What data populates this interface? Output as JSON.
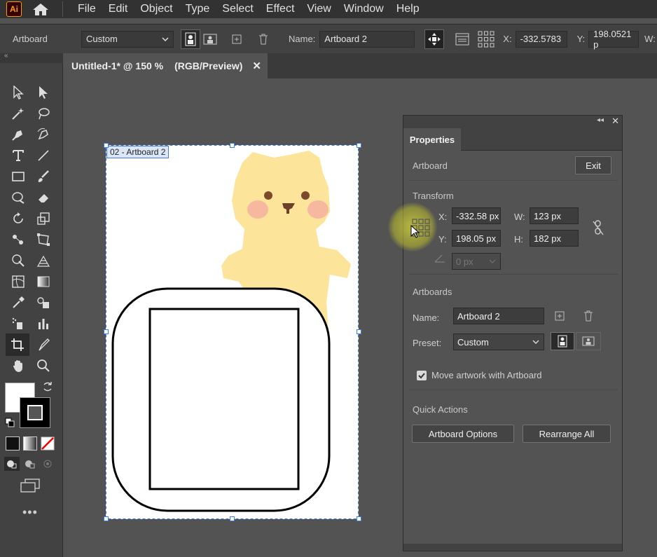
{
  "app": {
    "logo": "Ai"
  },
  "menu": [
    "File",
    "Edit",
    "Object",
    "Type",
    "Select",
    "Effect",
    "View",
    "Window",
    "Help"
  ],
  "control_bar": {
    "tool_label": "Artboard",
    "preset_value": "Custom",
    "name_label": "Name:",
    "name_value": "Artboard 2",
    "x_label": "X:",
    "x_value": "-332.5783",
    "y_label": "Y:",
    "y_value": "198.0521 p",
    "w_label": "W:"
  },
  "document_tab": {
    "title": "Untitled-1* @ 150 %",
    "mode": "(RGB/Preview)",
    "close": "✕"
  },
  "artboard": {
    "label": "02 - Artboard 2"
  },
  "properties": {
    "tab": "Properties",
    "context_label": "Artboard",
    "exit_label": "Exit",
    "transform": {
      "title": "Transform",
      "x_label": "X:",
      "x_value": "-332.58 px",
      "y_label": "Y:",
      "y_value": "198.05 px",
      "w_label": "W:",
      "w_value": "123 px",
      "h_label": "H:",
      "h_value": "182 px",
      "angle_value": "0 px"
    },
    "artboards": {
      "title": "Artboards",
      "name_label": "Name:",
      "name_value": "Artboard 2",
      "preset_label": "Preset:",
      "preset_value": "Custom",
      "move_artwork_label": "Move artwork with Artboard",
      "move_artwork_checked": true
    },
    "quick_actions": {
      "title": "Quick Actions",
      "artboard_options": "Artboard Options",
      "rearrange_all": "Rearrange All"
    }
  },
  "colors": {
    "accent_selection": "#3b7bf0",
    "bear_fill": "#fde49b",
    "bear_cheek": "#f7b8a0",
    "ui_bg": "#535353"
  }
}
